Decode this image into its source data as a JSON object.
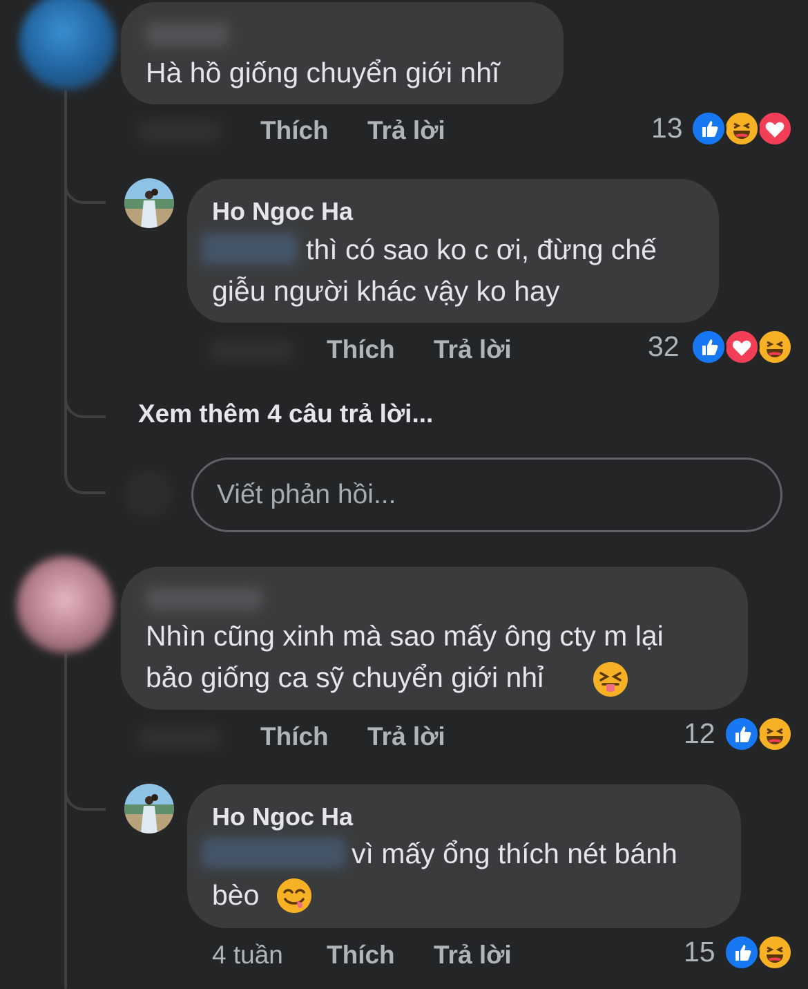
{
  "thread1": {
    "comment": {
      "text": "Hà hồ giống chuyển giới nhĩ",
      "actions": {
        "like": "Thích",
        "reply": "Trả lời"
      },
      "reaction_count": "13"
    },
    "reply": {
      "author": "Ho Ngoc Ha",
      "line1": "thì có sao ko c ơi, đừng chế",
      "line2": "giễu người khác vậy ko hay",
      "actions": {
        "like": "Thích",
        "reply": "Trả lời"
      },
      "reaction_count": "32"
    },
    "view_more": "Xem thêm 4 câu trả lời...",
    "reply_placeholder": "Viết phản hồi..."
  },
  "thread2": {
    "comment": {
      "line1": "Nhìn cũng xinh mà sao mấy ông cty m lại",
      "line2": "bảo giống ca sỹ chuyển giới nhỉ",
      "actions": {
        "like": "Thích",
        "reply": "Trả lời"
      },
      "reaction_count": "12"
    },
    "reply": {
      "author": "Ho Ngoc Ha",
      "line1": "vì mấy ổng thích nét bánh",
      "line2": "bèo",
      "time": "4 tuần",
      "actions": {
        "like": "Thích",
        "reply": "Trả lời"
      },
      "reaction_count": "15"
    }
  },
  "colors": {
    "background": "#242526",
    "bubble": "#3a3b3c",
    "secondary_text": "#b0b3b8",
    "like_blue": "#1877f2",
    "love_red": "#f33e58",
    "haha_yellow": "#f7b125"
  },
  "icons": [
    "like-reaction-icon",
    "haha-reaction-icon",
    "love-reaction-icon",
    "squinting-tongue-emoji",
    "yum-emoji"
  ]
}
